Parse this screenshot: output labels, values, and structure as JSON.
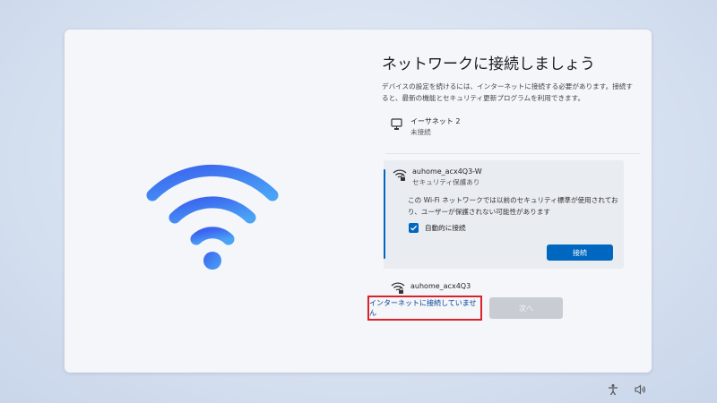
{
  "page": {
    "title": "ネットワークに接続しましょう",
    "description": "デバイスの設定を続けるには、インターネットに接続する必要があります。接続すると、最新の機能とセキュリティ更新プログラムを利用できます。"
  },
  "networks": {
    "ethernet": {
      "name": "イーサネット 2",
      "status": "未接続",
      "icon": "ethernet-icon"
    },
    "selected": {
      "name": "auhome_acx4Q3-W",
      "status": "セキュリティ保護あり",
      "icon": "wifi-lock-icon",
      "warning": "この Wi-Fi ネットワークでは以前のセキュリティ標準が使用されており、ユーザーが保護されない可能性があります",
      "auto_connect_label": "自動的に接続",
      "auto_connect_checked": true,
      "connect_label": "接続"
    },
    "other": {
      "name": "auhome_acx4Q3",
      "icon": "wifi-lock-icon"
    }
  },
  "footer": {
    "no_internet_label": "インターネットに接続していません",
    "next_label": "次へ"
  },
  "colors": {
    "accent": "#0067c0",
    "wifi_gradient_start": "#3d6ff0",
    "wifi_gradient_end": "#4aa0f5",
    "highlight_border": "#d9222a"
  },
  "tray": {
    "icons": [
      "accessibility-icon",
      "volume-icon"
    ]
  }
}
